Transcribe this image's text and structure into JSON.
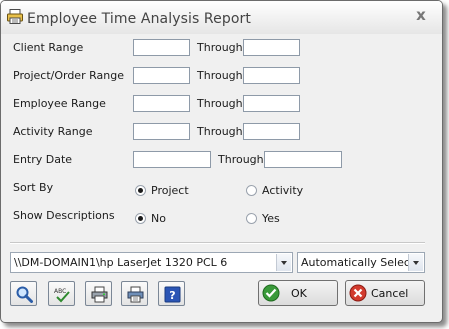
{
  "window": {
    "title": "Employee Time Analysis Report",
    "close_symbol": "x"
  },
  "ranges": [
    {
      "label": "Client Range",
      "through_label": "Through",
      "from_value": "",
      "to_value": ""
    },
    {
      "label": "Project/Order Range",
      "through_label": "Through",
      "from_value": "",
      "to_value": ""
    },
    {
      "label": "Employee Range",
      "through_label": "Through",
      "from_value": "",
      "to_value": ""
    },
    {
      "label": "Activity Range",
      "through_label": "Through",
      "from_value": "",
      "to_value": ""
    }
  ],
  "entry_date": {
    "label": "Entry Date",
    "through_label": "Through",
    "from_value": "",
    "to_value": ""
  },
  "sort_by": {
    "label": "Sort By",
    "options": [
      "Project",
      "Activity"
    ],
    "selected": "Project"
  },
  "show_descriptions": {
    "label": "Show Descriptions",
    "options": [
      "No",
      "Yes"
    ],
    "selected": "No"
  },
  "printer": {
    "selected": "\\\\DM-DOMAIN1\\hp LaserJet 1320 PCL 6"
  },
  "paper_source": {
    "selected": "Automatically Select"
  },
  "toolbar_icons": [
    "magnify-preview-icon",
    "spellcheck-icon",
    "print-icon",
    "print-setup-icon",
    "help-icon"
  ],
  "buttons": {
    "ok_label": "OK",
    "cancel_label": "Cancel"
  },
  "colors": {
    "ok_icon": "#3a9a3a",
    "cancel_icon": "#d23b2e"
  }
}
